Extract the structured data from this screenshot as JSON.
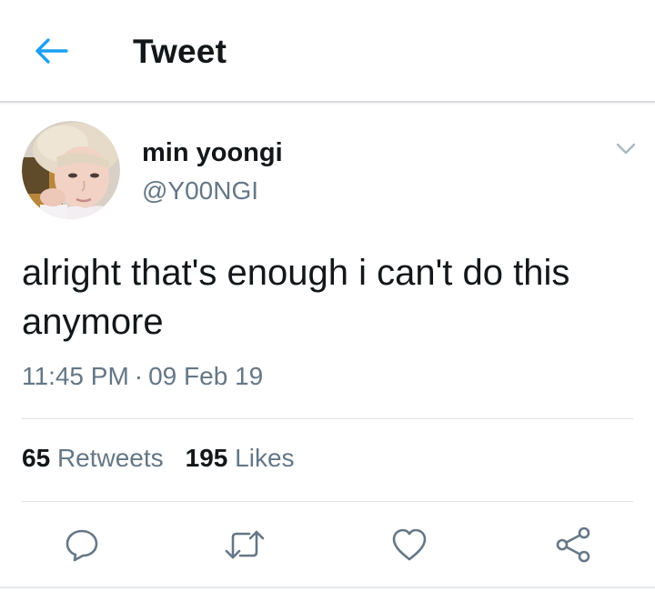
{
  "header": {
    "back_icon": "arrow-left-icon",
    "title": "Tweet"
  },
  "tweet": {
    "avatar_icon": "profile-photo",
    "display_name": "min yoongi",
    "handle": "@Y00NGI",
    "menu_icon": "chevron-down-icon",
    "text": "alright that's enough i can't do this anymore",
    "time": "11:45 PM",
    "separator": "·",
    "date": "09 Feb 19"
  },
  "stats": {
    "retweets_count": "65",
    "retweets_label": "Retweets",
    "likes_count": "195",
    "likes_label": "Likes"
  },
  "actions": [
    {
      "icon": "reply-icon"
    },
    {
      "icon": "retweet-icon"
    },
    {
      "icon": "heart-icon"
    },
    {
      "icon": "share-icon"
    }
  ],
  "colors": {
    "accent": "#1da1f2",
    "text_primary": "#14171a",
    "text_secondary": "#657786",
    "divider": "#dfe3e7"
  }
}
